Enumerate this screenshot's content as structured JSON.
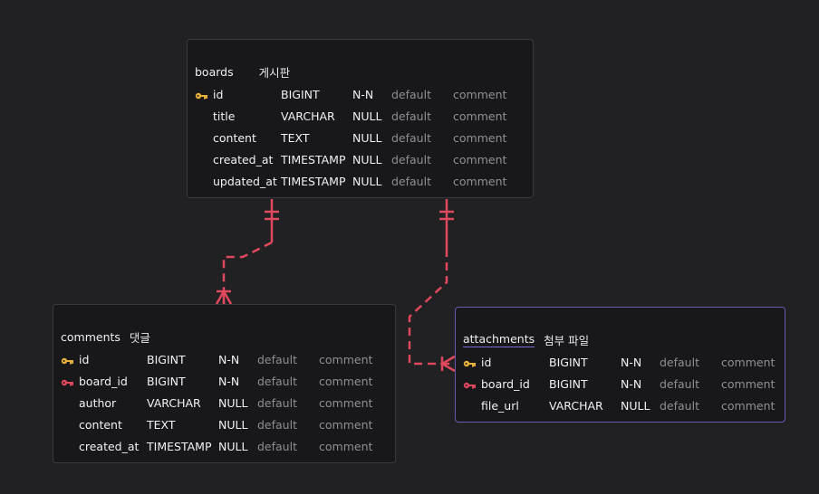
{
  "colors": {
    "background": "#212123",
    "relation_line": "#e0495d",
    "primary_key": "#e8b23a",
    "foreign_key": "#e0495d",
    "selected_border": "#6b5ab0"
  },
  "tables": {
    "boards": {
      "name": "boards",
      "comment": "게시판",
      "columns": [
        {
          "key": "primary",
          "icon": "key-icon",
          "name": "id",
          "type": "BIGINT",
          "nullable": "N-N",
          "default": "default",
          "comment": "comment"
        },
        {
          "key": "",
          "name": "title",
          "type": "VARCHAR",
          "nullable": "NULL",
          "default": "default",
          "comment": "comment"
        },
        {
          "key": "",
          "name": "content",
          "type": "TEXT",
          "nullable": "NULL",
          "default": "default",
          "comment": "comment"
        },
        {
          "key": "",
          "name": "created_at",
          "type": "TIMESTAMP",
          "nullable": "NULL",
          "default": "default",
          "comment": "comment"
        },
        {
          "key": "",
          "name": "updated_at",
          "type": "TIMESTAMP",
          "nullable": "NULL",
          "default": "default",
          "comment": "comment"
        }
      ]
    },
    "comments": {
      "name": "comments",
      "comment": "댓글",
      "columns": [
        {
          "key": "primary",
          "icon": "key-icon",
          "name": "id",
          "type": "BIGINT",
          "nullable": "N-N",
          "default": "default",
          "comment": "comment"
        },
        {
          "key": "foreign",
          "icon": "key-icon",
          "name": "board_id",
          "type": "BIGINT",
          "nullable": "N-N",
          "default": "default",
          "comment": "comment"
        },
        {
          "key": "",
          "name": "author",
          "type": "VARCHAR",
          "nullable": "NULL",
          "default": "default",
          "comment": "comment"
        },
        {
          "key": "",
          "name": "content",
          "type": "TEXT",
          "nullable": "NULL",
          "default": "default",
          "comment": "comment"
        },
        {
          "key": "",
          "name": "created_at",
          "type": "TIMESTAMP",
          "nullable": "NULL",
          "default": "default",
          "comment": "comment"
        }
      ]
    },
    "attachments": {
      "name": "attachments",
      "comment": "첨부 파일",
      "columns": [
        {
          "key": "primary",
          "icon": "key-icon",
          "name": "id",
          "type": "BIGINT",
          "nullable": "N-N",
          "default": "default",
          "comment": "comment"
        },
        {
          "key": "foreign",
          "icon": "key-icon",
          "name": "board_id",
          "type": "BIGINT",
          "nullable": "N-N",
          "default": "default",
          "comment": "comment"
        },
        {
          "key": "",
          "name": "file_url",
          "type": "VARCHAR",
          "nullable": "NULL",
          "default": "default",
          "comment": "comment"
        }
      ]
    }
  },
  "relations": [
    {
      "from": "boards.id",
      "to": "comments.board_id",
      "cardinality": "one-to-many",
      "line": "dashed"
    },
    {
      "from": "boards.id",
      "to": "attachments.board_id",
      "cardinality": "one-to-many",
      "line": "dashed"
    }
  ]
}
